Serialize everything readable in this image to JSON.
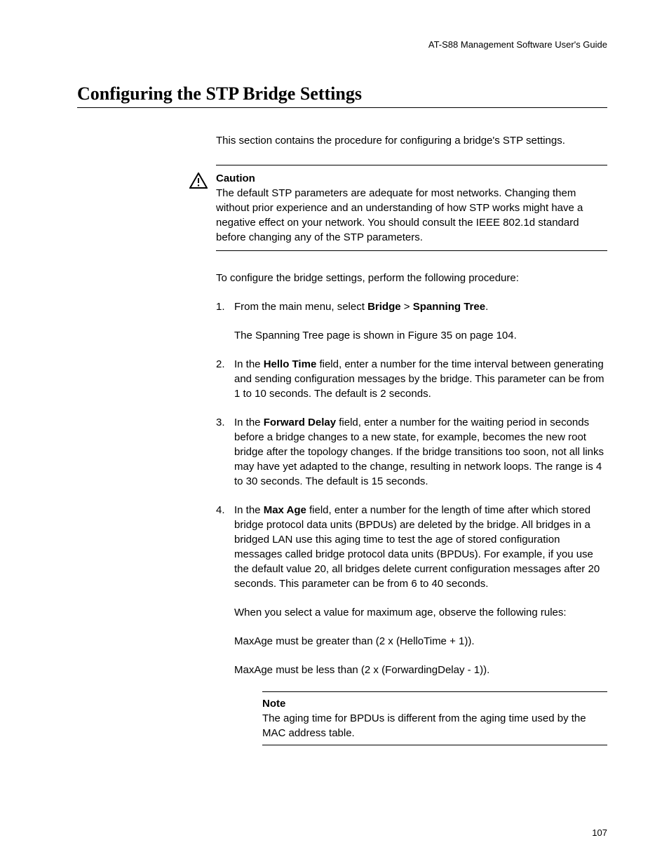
{
  "header": "AT-S88 Management Software User's Guide",
  "title": "Configuring the STP Bridge Settings",
  "intro": "This section contains the procedure for configuring a bridge's STP settings.",
  "caution": {
    "label": "Caution",
    "body": "The default STP parameters are adequate for most networks. Changing them without prior experience and an understanding of how STP works might have a negative effect on your network. You should consult the IEEE 802.1d standard before changing any of the STP parameters."
  },
  "procedureIntro": "To configure the bridge settings, perform the following procedure:",
  "steps": {
    "s1": {
      "pre": "From the main menu, select ",
      "b1": "Bridge",
      "mid": " > ",
      "b2": "Spanning Tree",
      "post": ".",
      "followup": "The Spanning Tree page is shown in Figure 35 on page 104."
    },
    "s2": {
      "pre": "In the ",
      "b1": "Hello Time",
      "post": " field, enter a number for the time interval between generating and sending configuration messages by the bridge. This parameter can be from 1 to 10 seconds. The default is 2 seconds."
    },
    "s3": {
      "pre": "In the ",
      "b1": "Forward Delay",
      "post": " field, enter a number for the waiting period in seconds before a bridge changes to a new state, for example, becomes the new root bridge after the topology changes. If the bridge transitions too soon, not all links may have yet adapted to the change, resulting in network loops. The range is 4 to 30 seconds. The default is 15 seconds."
    },
    "s4": {
      "pre": "In the ",
      "b1": "Max Age",
      "post": " field, enter a number for the length of time after which stored bridge protocol data units (BPDUs) are deleted by the bridge. All bridges in a bridged LAN use this aging time to test the age of stored configuration messages called bridge protocol data units (BPDUs). For example, if you use the default value 20, all bridges delete current configuration messages after 20 seconds. This parameter can be from 6 to 40 seconds.",
      "followup1": "When you select a value for maximum age, observe the following rules:",
      "followup2": "MaxAge must be greater than (2 x (HelloTime + 1)).",
      "followup3": "MaxAge must be less than (2 x (ForwardingDelay - 1))."
    }
  },
  "note": {
    "label": "Note",
    "body": "The aging time for BPDUs is different from the aging time used by the MAC address table."
  },
  "pageNumber": "107"
}
